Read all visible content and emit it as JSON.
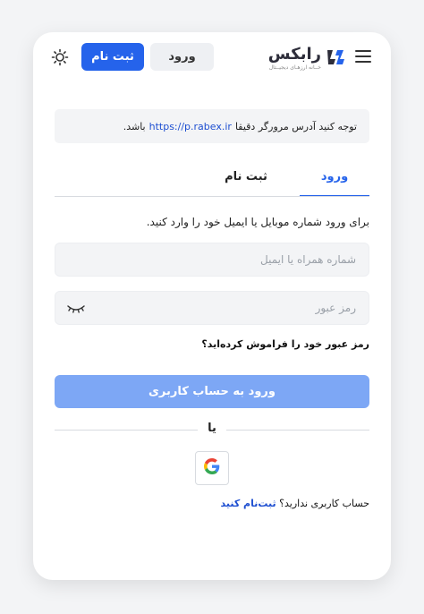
{
  "header": {
    "register_button": "ثبت نام",
    "login_button": "ورود",
    "logo_text": "رابکس",
    "logo_subtitle": "خــانه ارزهـای دیجیــتال",
    "theme_icon": "sun-icon",
    "menu_icon": "hamburger-icon"
  },
  "notice": {
    "text_before": "توجه کنید آدرس مرورگر دقیقا",
    "url": "https://p.rabex.ir",
    "text_after": "باشد."
  },
  "tabs": [
    {
      "label": "ورود",
      "active": true
    },
    {
      "label": "ثبت نام",
      "active": false
    }
  ],
  "form": {
    "instruction": "برای ورود شماره موبایل یا ایمیل خود را وارد کنید.",
    "phone_placeholder": "شماره همراه یا ایمیل",
    "phone_value": "",
    "password_placeholder": "رمز عبور",
    "password_value": "",
    "forgot_link": "رمز عبور خود را فراموش کرده‌اید؟",
    "submit_label": "ورود به حساب کاربری",
    "or_text": "یا",
    "google_icon": "google-icon",
    "no_account_text": "حساب کاربری ندارید؟",
    "signup_link": "ثبت‌نام کنید"
  },
  "colors": {
    "primary": "#2563eb",
    "submit_disabled": "#7da7f5",
    "link": "#1e4fd1",
    "field_bg": "#f3f4f6"
  }
}
